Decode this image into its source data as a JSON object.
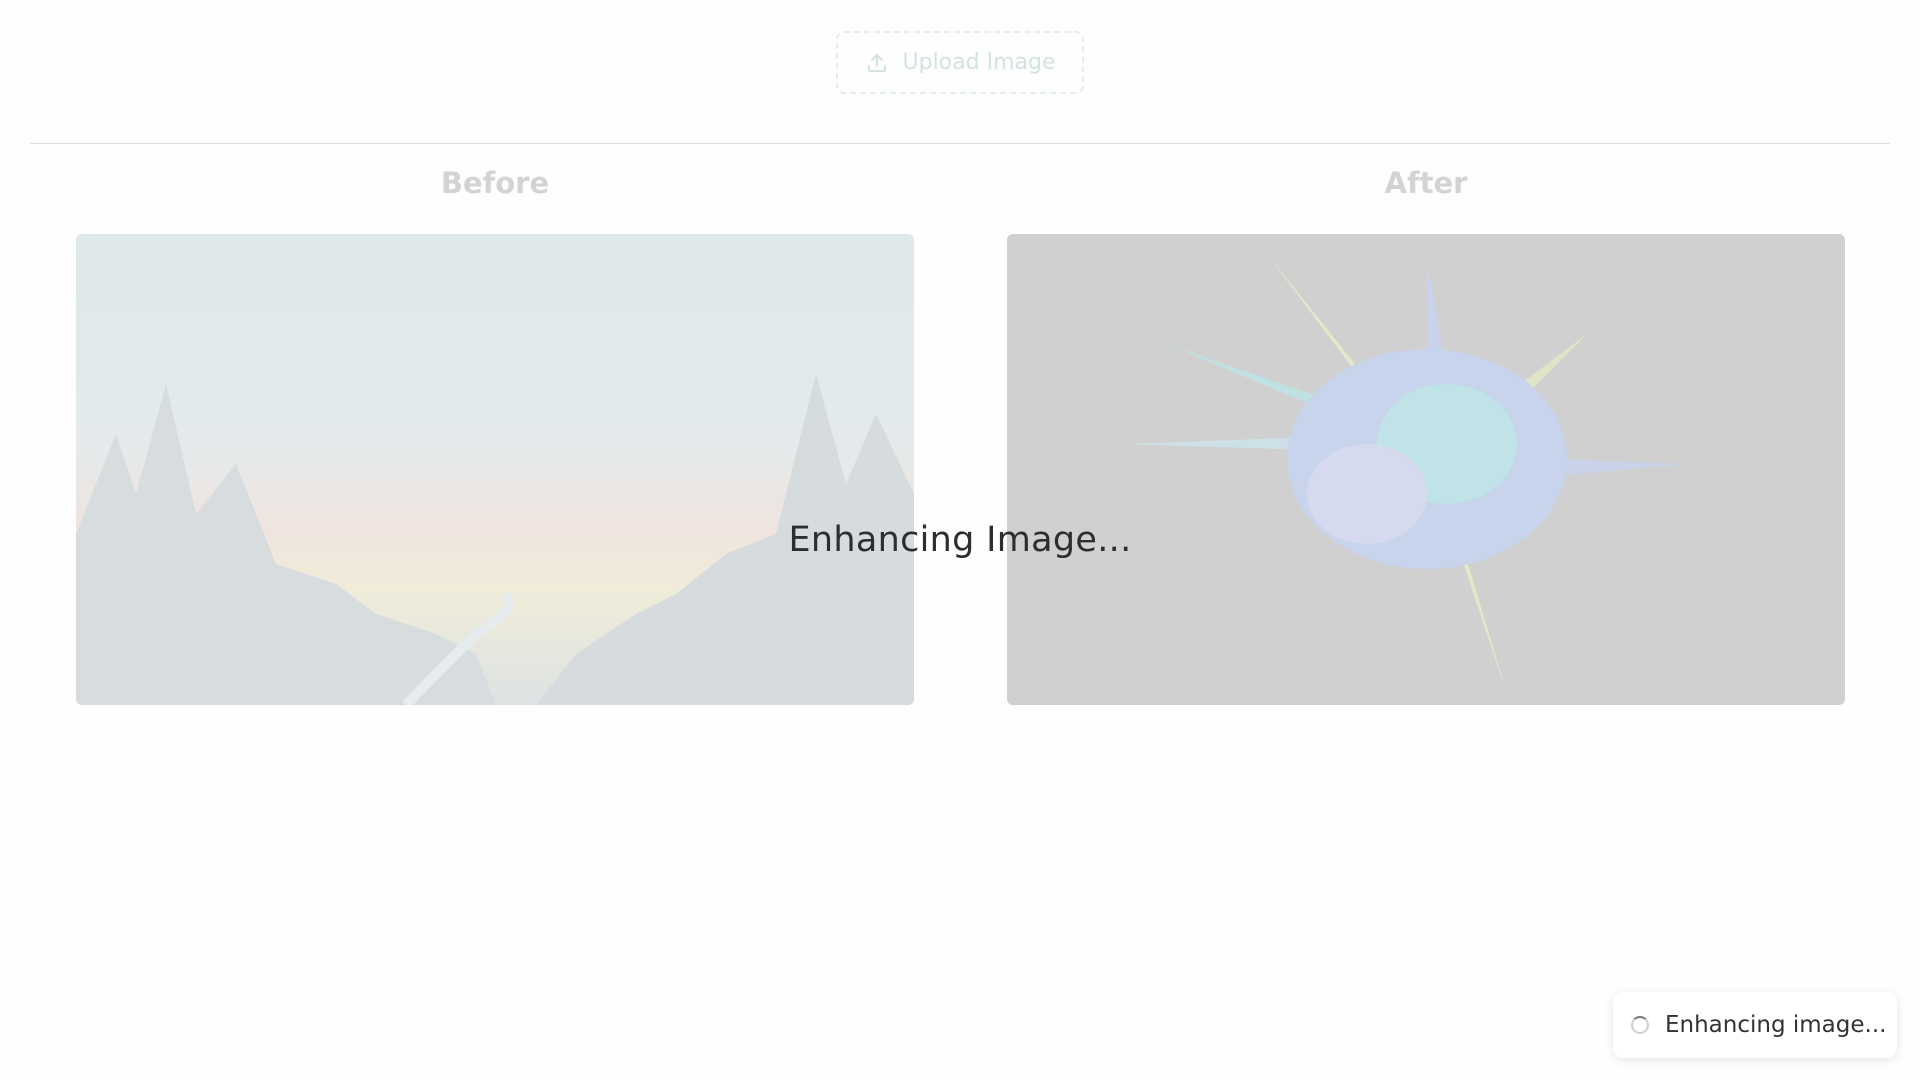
{
  "upload": {
    "label": "Upload Image",
    "icon": "upload-icon"
  },
  "compare": {
    "before_title": "Before",
    "after_title": "After"
  },
  "overlay": {
    "status": "Enhancing Image..."
  },
  "toast": {
    "message": "Enhancing image...",
    "icon": "spinner-icon"
  },
  "colors": {
    "accent": "#d2e5dc",
    "title_muted": "#d3d3d3",
    "overlay_text": "#2e2e2e"
  }
}
